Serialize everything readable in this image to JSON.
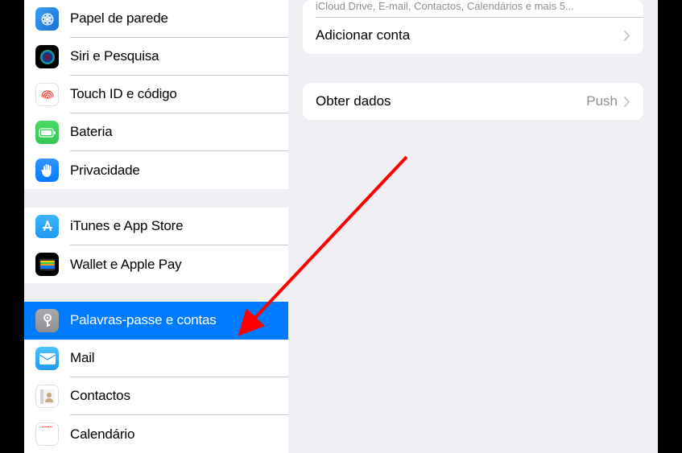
{
  "sidebar": {
    "group1": [
      {
        "label": "Papel de parede",
        "icon": "wallpaper"
      },
      {
        "label": "Siri e Pesquisa",
        "icon": "siri"
      },
      {
        "label": "Touch ID e código",
        "icon": "touchid"
      },
      {
        "label": "Bateria",
        "icon": "battery"
      },
      {
        "label": "Privacidade",
        "icon": "privacy"
      }
    ],
    "group2": [
      {
        "label": "iTunes e App Store",
        "icon": "itunes"
      },
      {
        "label": "Wallet e Apple Pay",
        "icon": "wallet"
      }
    ],
    "group3": [
      {
        "label": "Palavras-passe e contas",
        "icon": "passwords",
        "selected": true
      },
      {
        "label": "Mail",
        "icon": "mail"
      },
      {
        "label": "Contactos",
        "icon": "contacts"
      },
      {
        "label": "Calendário",
        "icon": "calendar"
      }
    ]
  },
  "detail": {
    "truncated_sub": "iCloud Drive, E-mail, Contactos, Calendários e mais 5...",
    "add_account": "Adicionar conta",
    "get_data": {
      "label": "Obter dados",
      "value": "Push"
    }
  },
  "colors": {
    "accent": "#007aff",
    "bg": "#efeff4",
    "arrow": "#ff0000"
  }
}
